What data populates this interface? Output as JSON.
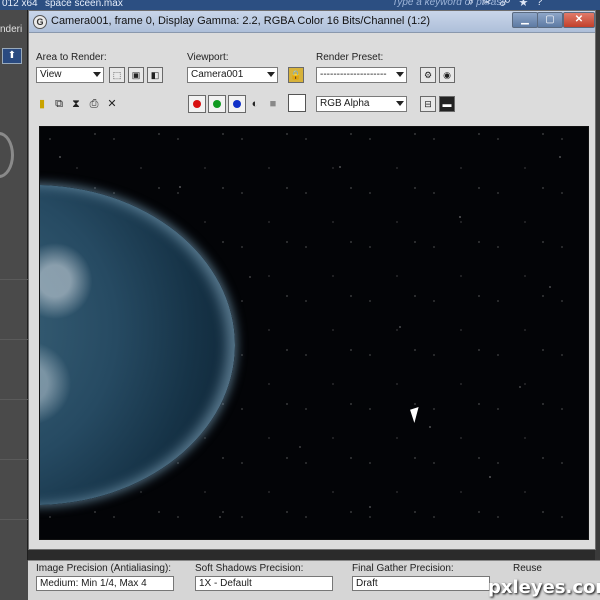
{
  "app": {
    "title_left": "012 x64",
    "file_name": "space sceen.max",
    "search_placeholder": "Type a keyword or phrase",
    "left_label": "nderi"
  },
  "window": {
    "title": "Camera001, frame 0, Display Gamma: 2.2, RGBA Color 16 Bits/Channel (1:2)",
    "icon": "G"
  },
  "toolbar": {
    "area_label": "Area to Render:",
    "area_value": "View",
    "viewport_label": "Viewport:",
    "viewport_value": "Camera001",
    "preset_label": "Render Preset:",
    "preset_value": "--------------------",
    "channel_value": "RGB Alpha"
  },
  "bottom": {
    "image_precision_label": "Image Precision (Antialiasing):",
    "image_precision_value": "Medium: Min 1/4, Max 4",
    "soft_shadows_label": "Soft Shadows Precision:",
    "soft_shadows_value": "1X - Default",
    "final_gather_label": "Final Gather Precision:",
    "final_gather_value": "Draft",
    "reuse_label": "Reuse"
  },
  "watermark": "pxleyes.com",
  "colors": {
    "red_channel": "#d81010",
    "green_channel": "#109a20",
    "blue_channel": "#1030c8"
  }
}
